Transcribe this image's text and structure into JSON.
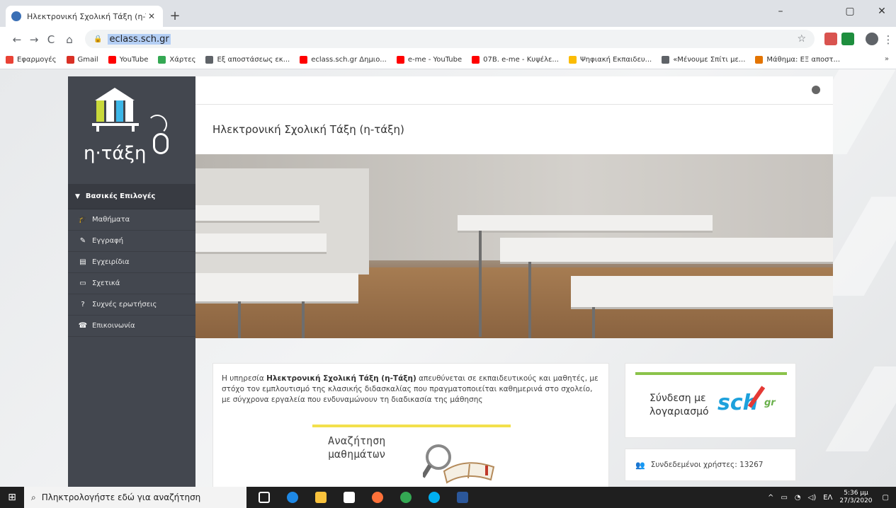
{
  "browser": {
    "tab_title": "Ηλεκτρονική Σχολική Τάξη (η-Τά",
    "tab_close": "✕",
    "new_tab": "+",
    "url": "eclass.sch.gr",
    "window_controls": {
      "minimize": "–",
      "maximize": "▢",
      "close": "✕"
    },
    "nav": {
      "back": "←",
      "forward": "→",
      "reload": "C",
      "home": "⌂"
    },
    "bookmarks": [
      {
        "label": "Εφαρμογές",
        "color": "#e94235"
      },
      {
        "label": "Gmail",
        "color": "#d93025"
      },
      {
        "label": "YouTube",
        "color": "#ff0000"
      },
      {
        "label": "Χάρτες",
        "color": "#34a853"
      },
      {
        "label": "Εξ αποστάσεως εκ...",
        "color": "#5f6368"
      },
      {
        "label": "eclass.sch.gr Δημιο...",
        "color": "#ff0000"
      },
      {
        "label": "e-me - YouTube",
        "color": "#ff0000"
      },
      {
        "label": "07Β. e-me - Κυψέλε...",
        "color": "#ff0000"
      },
      {
        "label": "Ψηφιακή Εκπαιδευ...",
        "color": "#fbbc04"
      },
      {
        "label": "«Μένουμε Σπίτι με...",
        "color": "#5f6368"
      },
      {
        "label": "Μάθημα: ΕΞ αποστ...",
        "color": "#e37400"
      }
    ],
    "bookmarks_more": "»"
  },
  "sidebar": {
    "logo_text": "η·τάξη",
    "section_title": "Βασικές Επιλογές",
    "items": [
      {
        "label": "Μαθήματα",
        "icon": "graduation-cap-icon",
        "glyph": "🎓"
      },
      {
        "label": "Εγγραφή",
        "icon": "edit-icon",
        "glyph": "✎"
      },
      {
        "label": "Εγχειρίδια",
        "icon": "document-icon",
        "glyph": "▤"
      },
      {
        "label": "Σχετικά",
        "icon": "card-icon",
        "glyph": "▭"
      },
      {
        "label": "Συχνές ερωτήσεις",
        "icon": "question-icon",
        "glyph": "?"
      },
      {
        "label": "Επικοινωνία",
        "icon": "phone-icon",
        "glyph": "☎"
      }
    ]
  },
  "main": {
    "page_title": "Ηλεκτρονική Σχολική Τάξη (η-τάξη)",
    "intro_prefix": "Η υπηρεσία ",
    "intro_bold": "Ηλεκτρονική Σχολική Τάξη (η-Τάξη)",
    "intro_rest": " απευθύνεται σε εκπαιδευτικούς και μαθητές, με στόχο τον εμπλουτισμό της κλασικής διδασκαλίας που πραγματοποιείται καθημερινά στο σχολείο, με σύγχρονα εργαλεία που ενδυναμώνουν τη διαδικασία της μάθησης",
    "search_line1": "Αναζήτηση",
    "search_line2": "μαθημάτων",
    "login_line1": "Σύνδεση με",
    "login_line2": "λογαριασμό",
    "sch_logo": "sch",
    "sch_gr": "gr",
    "users_label": "Συνδεδεμένοι χρήστες: 13267"
  },
  "taskbar": {
    "search_placeholder": "Πληκτρολογήστε εδώ για αναζήτηση",
    "language": "ΕΛ",
    "time": "5:36 μμ",
    "date": "27/3/2020"
  },
  "colors": {
    "sidebar_bg": "#43474f",
    "accent_yellow": "#f3e04c",
    "accent_green": "#8bc34a",
    "sch_blue": "#1da1dc"
  }
}
